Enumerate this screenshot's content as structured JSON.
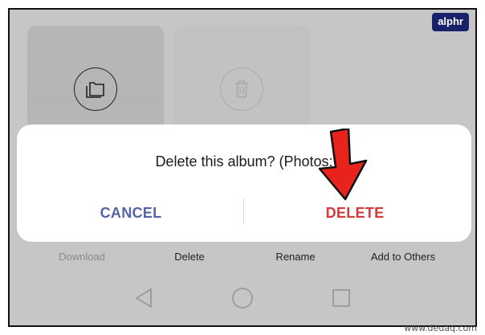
{
  "tiles": [
    {
      "icon": "folder-icon"
    },
    {
      "icon": "trash-icon"
    }
  ],
  "dialog": {
    "message": "Delete this album? (Photos:",
    "cancel_label": "CANCEL",
    "delete_label": "DELETE"
  },
  "actions": [
    {
      "label": "Download"
    },
    {
      "label": "Delete"
    },
    {
      "label": "Rename"
    },
    {
      "label": "Add to Others"
    }
  ],
  "nav": [
    "back-icon",
    "home-icon",
    "recents-icon"
  ],
  "brand": "alphr",
  "watermark": "www.deuaq.com",
  "colors": {
    "cancel": "#5564a8",
    "delete": "#d33a3a",
    "arrow": "#e8231c",
    "brand_bg": "#17226b"
  }
}
